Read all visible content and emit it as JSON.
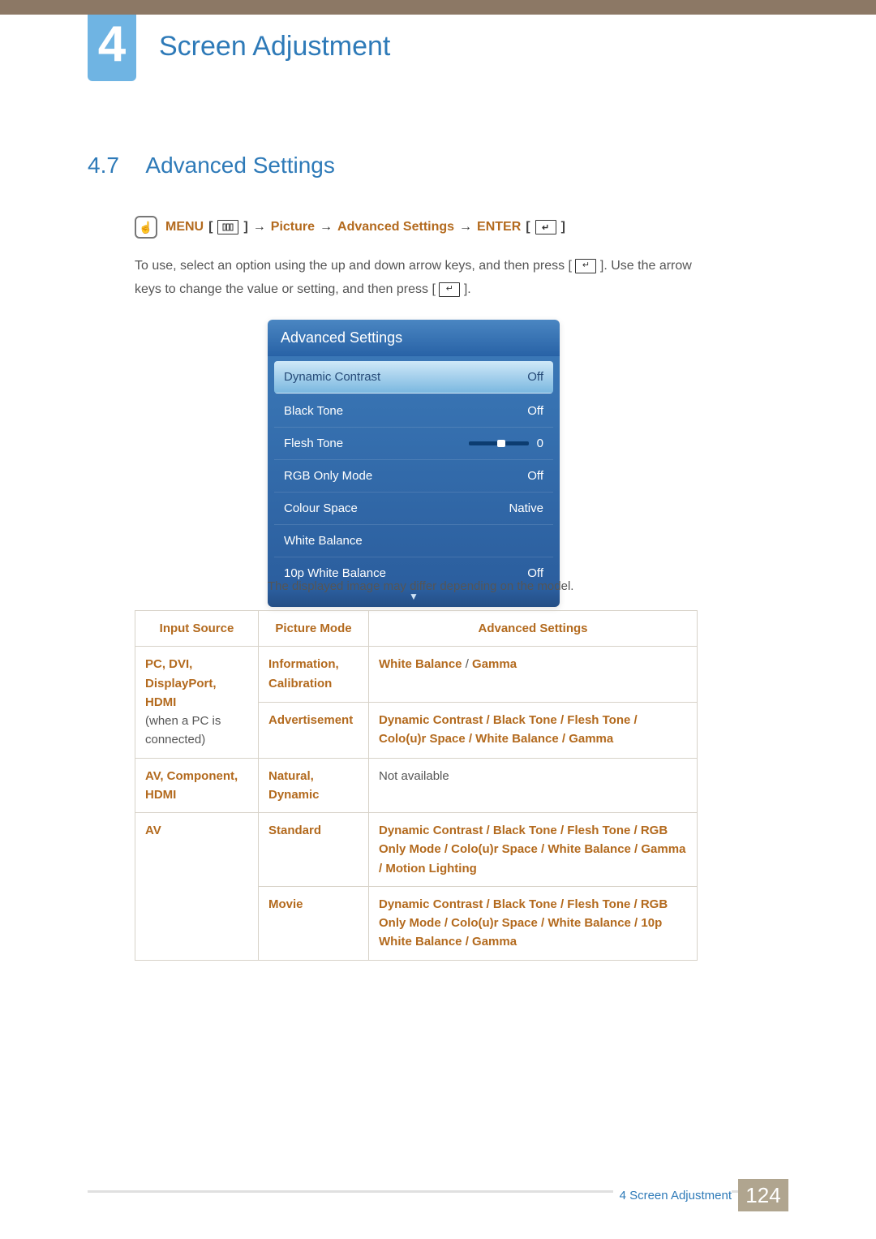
{
  "chapter": {
    "number": "4",
    "title": "Screen Adjustment"
  },
  "section": {
    "number": "4.7",
    "title": "Advanced Settings"
  },
  "nav_path": {
    "menu_label": "MENU",
    "arrow": "→",
    "crumb1": "Picture",
    "crumb2": "Advanced Settings",
    "enter_label": "ENTER"
  },
  "instructions": {
    "line1_a": "To use, select an option using the up and down arrow keys, and then press [",
    "line1_b": "]. Use the arrow keys to change the value or setting, and then press [",
    "line1_c": "]."
  },
  "osd": {
    "title": "Advanced Settings",
    "rows": [
      {
        "label": "Dynamic Contrast",
        "value": "Off",
        "selected": true
      },
      {
        "label": "Black Tone",
        "value": "Off"
      },
      {
        "label": "Flesh Tone",
        "value": "0",
        "slider": true
      },
      {
        "label": "RGB Only Mode",
        "value": "Off"
      },
      {
        "label": "Colour Space",
        "value": "Native"
      },
      {
        "label": "White Balance",
        "value": ""
      },
      {
        "label": "10p White Balance",
        "value": "Off"
      }
    ],
    "more": "▼"
  },
  "osd_note": "The displayed image may differ depending on the model.",
  "table": {
    "headers": {
      "c1": "Input Source",
      "c2": "Picture Mode",
      "c3": "Advanced Settings"
    },
    "r1": {
      "src_orange": "PC, DVI, DisplayPort, HDMI",
      "src_grey": "(when a PC is connected)",
      "pm_a": "Information, Calibration",
      "adv_a1": "White Balance",
      "adv_a_sep": " / ",
      "adv_a2": "Gamma",
      "pm_b": "Advertisement",
      "adv_b": "Dynamic Contrast / Black Tone / Flesh Tone / Colo(u)r Space / White Balance / Gamma"
    },
    "r2": {
      "src": "AV, Component, HDMI",
      "pm": "Natural, Dynamic",
      "adv": "Not available"
    },
    "r3": {
      "src": "AV",
      "pm_a": "Standard",
      "adv_a": "Dynamic Contrast / Black Tone / Flesh Tone / RGB Only Mode / Colo(u)r Space / White Balance / Gamma / Motion Lighting",
      "pm_b": "Movie",
      "adv_b": "Dynamic Contrast / Black Tone / Flesh Tone / RGB Only Mode / Colo(u)r Space / White Balance / 10p White Balance / Gamma"
    }
  },
  "footer": {
    "chapter": "4 Screen Adjustment",
    "page": "124"
  }
}
